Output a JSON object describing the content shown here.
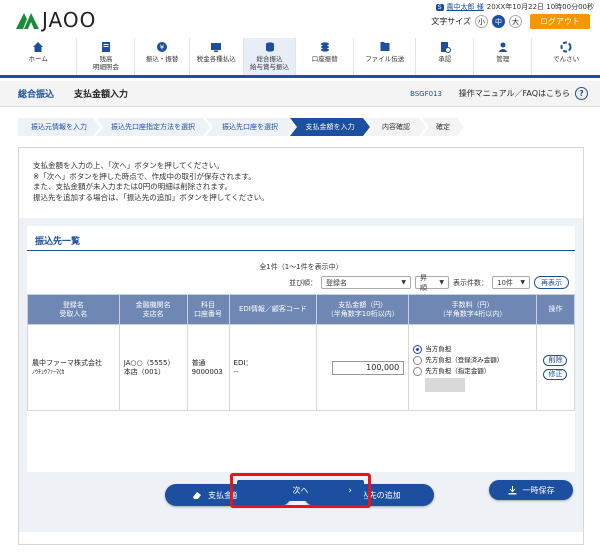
{
  "header": {
    "logo": "JAOO",
    "user_badge": "S",
    "user_name": "農中太郎 様",
    "last_login": "20XX年10月22日 10時00分00秒",
    "font_size_label": "文字サイズ",
    "font_small": "小",
    "font_medium": "中",
    "font_large": "大",
    "logout_label": "ログアウト"
  },
  "nav": [
    {
      "label": "ホーム",
      "icon": "home-icon"
    },
    {
      "label": "残高\n明細照会",
      "icon": "document-icon"
    },
    {
      "label": "振込・振替",
      "icon": "yen-icon"
    },
    {
      "label": "税金各種払込",
      "icon": "monitor-icon"
    },
    {
      "label": "総合振込\n給与賞与振込",
      "icon": "coins-icon"
    },
    {
      "label": "口座振替",
      "icon": "stack-icon"
    },
    {
      "label": "ファイル伝送",
      "icon": "file-icon"
    },
    {
      "label": "承認",
      "icon": "approve-icon"
    },
    {
      "label": "管理",
      "icon": "admin-icon"
    },
    {
      "label": "でんさい",
      "icon": "densai-icon"
    }
  ],
  "page": {
    "category": "総合振込",
    "title": "支払金額入力",
    "screen_code": "BSGF013",
    "help_label": "操作マニュアル／FAQはこちら",
    "help_icon": "?"
  },
  "steps": [
    "振込元情報を入力",
    "振込先口座指定方法を選択",
    "振込先口座を選択",
    "支払金額を入力",
    "内容確認",
    "確定"
  ],
  "instructions": [
    "支払金額を入力の上、「次へ」ボタンを押してください。",
    "※「次へ」ボタンを押した時点で、作成中の取引が保存されます。",
    "また、支払金額が未入力または0円の明細は削除されます。",
    "振込先を追加する場合は、「振込先の追加」ボタンを押してください。"
  ],
  "list": {
    "title": "振込先一覧",
    "count_text": "全1件（1～1件を表示中）",
    "sort_label": "並び順：",
    "sort_value": "登録名",
    "order_value": "昇順",
    "per_page_label": "表示件数：",
    "per_page_value": "10件",
    "redisplay_label": "再表示",
    "columns": {
      "name": "登録名\n受取人名",
      "bank": "金融機関名\n支店名",
      "account": "科目\n口座番号",
      "edi": "EDI情報／顧客コード",
      "amount": "支払金額（円）\n（半角数字10桁以内）",
      "fee": "手数料（円）\n（半角数字4桁以内）",
      "ops": "操作"
    },
    "rows": [
      {
        "name": "農中ファーマ株式会社",
        "kana": "ﾉｳﾁｭｳﾌｧｰﾏ(ｶ",
        "bank": "JA○○（5555）",
        "branch": "本店（001）",
        "type": "普通",
        "account": "9000003",
        "edi_label": "EDI：",
        "edi_value": "--",
        "amount": "100,000",
        "fee_options": [
          "当方負担",
          "先方負担（登録済み金額）",
          "先方負担（指定金額）"
        ],
        "fee_selected": 0,
        "delete_label": "削除",
        "edit_label": "修正"
      }
    ]
  },
  "buttons": {
    "clear_amount": "支払金額クリア",
    "add_payee": "振込先の追加",
    "next": "次へ",
    "next_chevron": "›",
    "temp_save": "一時保存"
  }
}
